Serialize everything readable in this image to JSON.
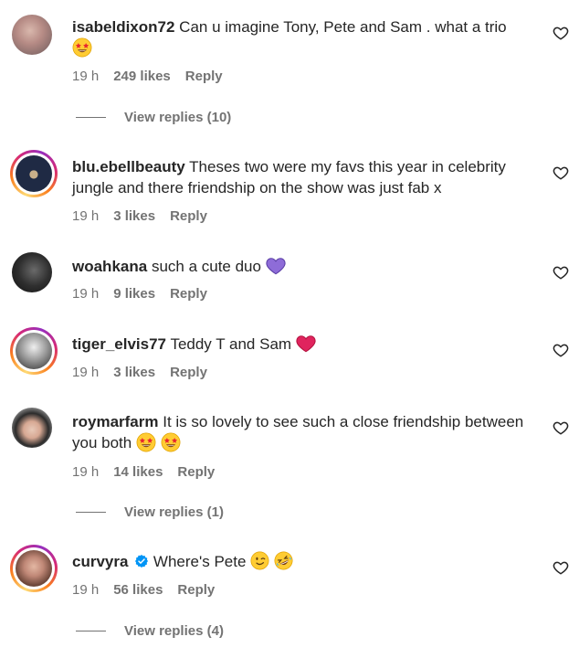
{
  "comments": [
    {
      "username": "isabeldixon72",
      "text": "Can u imagine Tony, Pete and Sam . what a trio",
      "time": "19 h",
      "likes": "249 likes",
      "reply": "Reply",
      "view_replies": "View replies (10)"
    },
    {
      "username": "blu.ebellbeauty",
      "text": "Theses two were my favs this year in celebrity jungle and there friendship on the show was just fab x",
      "time": "19 h",
      "likes": "3 likes",
      "reply": "Reply"
    },
    {
      "username": "woahkana",
      "text": "such a cute duo",
      "time": "19 h",
      "likes": "9 likes",
      "reply": "Reply"
    },
    {
      "username": "tiger_elvis77",
      "text": "Teddy T and Sam",
      "time": "19 h",
      "likes": "3 likes",
      "reply": "Reply"
    },
    {
      "username": "roymarfarm",
      "text": "It is so lovely to see such a close friendship between you both",
      "time": "19 h",
      "likes": "14 likes",
      "reply": "Reply",
      "view_replies": "View replies (1)"
    },
    {
      "username": "curvyra",
      "text": "Where's Pete",
      "time": "19 h",
      "likes": "56 likes",
      "reply": "Reply",
      "view_replies": "View replies (4)"
    }
  ],
  "icons": {
    "like": "heart-outline-icon",
    "star_struck": "star-struck-emoji",
    "purple_heart": "purple-heart-emoji",
    "red_heart": "red-heart-emoji",
    "winking": "winking-face-emoji",
    "laughing": "rolling-laughing-emoji",
    "verified": "verified-badge-icon"
  },
  "colors": {
    "text": "#262626",
    "secondary": "#737373",
    "verified": "#0095f6",
    "purple_heart": "#8e6cd8",
    "red_heart": "#e0245e"
  }
}
